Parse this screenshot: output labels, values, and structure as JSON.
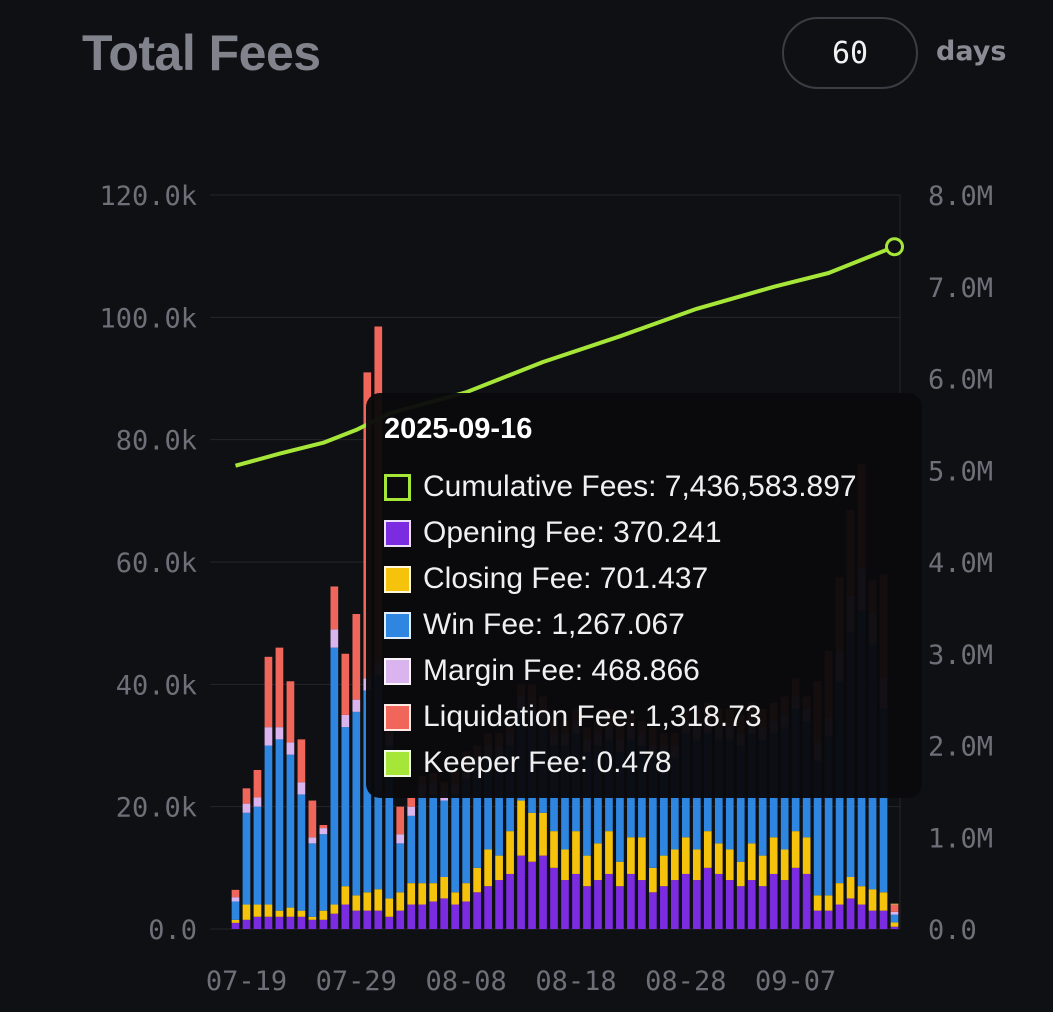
{
  "header": {
    "title": "Total Fees",
    "days_value": "60",
    "days_unit": "days"
  },
  "colors": {
    "opening": "#7b2be0",
    "closing": "#f5c20c",
    "win": "#2e86e0",
    "margin": "#d9b4ef",
    "liquidation": "#f0665a",
    "keeper": "#a6e639",
    "cumulative": "#a6e639"
  },
  "chart_data": {
    "type": "bar",
    "title": "Total Fees",
    "x_tick_labels": [
      "07-19",
      "07-29",
      "08-08",
      "08-18",
      "08-28",
      "09-07"
    ],
    "y_left_tick_labels": [
      "0.0",
      "20.0k",
      "40.0k",
      "60.0k",
      "80.0k",
      "100.0k",
      "120.0k"
    ],
    "y_right_tick_labels": [
      "0.0",
      "1.0M",
      "2.0M",
      "3.0M",
      "4.0M",
      "5.0M",
      "6.0M",
      "7.0M",
      "8.0M"
    ],
    "ylim_left": [
      0,
      120000
    ],
    "ylim_right": [
      0,
      8000000
    ],
    "stack_order": [
      "Opening Fee",
      "Closing Fee",
      "Win Fee",
      "Margin Fee",
      "Liquidation Fee",
      "Keeper Fee"
    ],
    "bars": [
      {
        "date": "07-18",
        "values": [
          1000,
          500,
          3000,
          700,
          1200,
          0
        ]
      },
      {
        "date": "07-19",
        "values": [
          1500,
          2500,
          15000,
          1500,
          2500,
          0
        ]
      },
      {
        "date": "07-20",
        "values": [
          2000,
          2000,
          16000,
          1500,
          4500,
          0
        ]
      },
      {
        "date": "07-21",
        "values": [
          2000,
          2000,
          26000,
          3000,
          11500,
          0
        ]
      },
      {
        "date": "07-22",
        "values": [
          2000,
          1000,
          28000,
          2000,
          13000,
          0
        ]
      },
      {
        "date": "07-23",
        "values": [
          2000,
          1500,
          25000,
          2000,
          10000,
          0
        ]
      },
      {
        "date": "07-24",
        "values": [
          2000,
          1000,
          19000,
          2000,
          7000,
          0
        ]
      },
      {
        "date": "07-25",
        "values": [
          1500,
          500,
          12000,
          1000,
          6000,
          0
        ]
      },
      {
        "date": "07-26",
        "values": [
          1500,
          1500,
          12500,
          1000,
          500,
          0
        ]
      },
      {
        "date": "07-27",
        "values": [
          2500,
          1500,
          42000,
          3000,
          7000,
          0
        ]
      },
      {
        "date": "07-28",
        "values": [
          4000,
          3000,
          26000,
          2000,
          10000,
          0
        ]
      },
      {
        "date": "07-29",
        "values": [
          3000,
          2500,
          30000,
          2000,
          14000,
          0
        ]
      },
      {
        "date": "07-30",
        "values": [
          3000,
          3000,
          33000,
          2000,
          50000,
          0
        ]
      },
      {
        "date": "07-31",
        "values": [
          3000,
          3500,
          35000,
          2000,
          55000,
          0
        ]
      },
      {
        "date": "08-01",
        "values": [
          2000,
          3000,
          25000,
          2000,
          3000,
          0
        ]
      },
      {
        "date": "08-02",
        "values": [
          3000,
          3000,
          8000,
          1500,
          4500,
          0
        ]
      },
      {
        "date": "08-03",
        "values": [
          4000,
          3500,
          11000,
          1500,
          1500,
          0
        ]
      },
      {
        "date": "08-04",
        "values": [
          4000,
          3500,
          14000,
          2000,
          1500,
          0
        ]
      },
      {
        "date": "08-05",
        "values": [
          4500,
          3000,
          14500,
          2000,
          1500,
          0
        ]
      },
      {
        "date": "08-06",
        "values": [
          5000,
          3500,
          12500,
          1500,
          1500,
          0
        ]
      },
      {
        "date": "08-07",
        "values": [
          4000,
          2000,
          16000,
          1500,
          2500,
          0
        ]
      },
      {
        "date": "08-08",
        "values": [
          4500,
          3000,
          17000,
          2000,
          2500,
          0
        ]
      },
      {
        "date": "08-09",
        "values": [
          6000,
          4000,
          16000,
          2000,
          2000,
          0
        ]
      },
      {
        "date": "08-10",
        "values": [
          7000,
          6000,
          15000,
          2000,
          2000,
          0
        ]
      },
      {
        "date": "08-11",
        "values": [
          8000,
          4000,
          16000,
          2000,
          2000,
          0
        ]
      },
      {
        "date": "08-12",
        "values": [
          9000,
          7000,
          14000,
          2000,
          1000,
          0
        ]
      },
      {
        "date": "08-13",
        "values": [
          12000,
          9000,
          15000,
          2000,
          2000,
          0
        ]
      },
      {
        "date": "08-14",
        "values": [
          11000,
          8000,
          16000,
          2000,
          3000,
          0
        ]
      },
      {
        "date": "08-15",
        "values": [
          12000,
          7000,
          15000,
          2000,
          2000,
          0
        ]
      },
      {
        "date": "08-16",
        "values": [
          10000,
          6000,
          14000,
          2000,
          2000,
          0
        ]
      },
      {
        "date": "08-17",
        "values": [
          8000,
          5000,
          17000,
          2000,
          2000,
          0
        ]
      },
      {
        "date": "08-18",
        "values": [
          9000,
          7000,
          16000,
          2000,
          2000,
          0
        ]
      },
      {
        "date": "08-19",
        "values": [
          7000,
          5000,
          17000,
          2000,
          2000,
          0
        ]
      },
      {
        "date": "08-20",
        "values": [
          8000,
          6000,
          16000,
          2000,
          2000,
          0
        ]
      },
      {
        "date": "08-21",
        "values": [
          9000,
          7000,
          15000,
          2000,
          3000,
          0
        ]
      },
      {
        "date": "08-22",
        "values": [
          7000,
          4000,
          18000,
          2000,
          3000,
          0
        ]
      },
      {
        "date": "08-23",
        "values": [
          9000,
          6000,
          16000,
          2000,
          2000,
          0
        ]
      },
      {
        "date": "08-24",
        "values": [
          8000,
          7000,
          15000,
          2000,
          2000,
          0
        ]
      },
      {
        "date": "08-25",
        "values": [
          6000,
          4000,
          18000,
          2000,
          3000,
          0
        ]
      },
      {
        "date": "08-26",
        "values": [
          7000,
          5000,
          16000,
          2000,
          2000,
          0
        ]
      },
      {
        "date": "08-27",
        "values": [
          8000,
          5000,
          15000,
          2000,
          2000,
          0
        ]
      },
      {
        "date": "08-28",
        "values": [
          9000,
          6000,
          17000,
          2000,
          2000,
          0
        ]
      },
      {
        "date": "08-29",
        "values": [
          8000,
          5000,
          18000,
          2000,
          3000,
          0
        ]
      },
      {
        "date": "08-30",
        "values": [
          10000,
          6000,
          16000,
          2000,
          3000,
          0
        ]
      },
      {
        "date": "08-31",
        "values": [
          9000,
          5000,
          17000,
          2000,
          3000,
          0
        ]
      },
      {
        "date": "09-01",
        "values": [
          8000,
          5000,
          18000,
          2000,
          3000,
          0
        ]
      },
      {
        "date": "09-02",
        "values": [
          7000,
          4000,
          19000,
          2000,
          3000,
          0
        ]
      },
      {
        "date": "09-03",
        "values": [
          8000,
          6000,
          18000,
          2000,
          3000,
          0
        ]
      },
      {
        "date": "09-04",
        "values": [
          7000,
          5000,
          19000,
          2000,
          3000,
          0
        ]
      },
      {
        "date": "09-05",
        "values": [
          9000,
          6000,
          17000,
          2000,
          3000,
          0
        ]
      },
      {
        "date": "09-06",
        "values": [
          8000,
          5000,
          20000,
          2000,
          3000,
          0
        ]
      },
      {
        "date": "09-07",
        "values": [
          10000,
          6000,
          20000,
          2000,
          3000,
          0
        ]
      },
      {
        "date": "09-08",
        "values": [
          9000,
          6000,
          19000,
          2000,
          2000,
          0
        ]
      },
      {
        "date": "09-09",
        "values": [
          3000,
          2500,
          22000,
          3000,
          10000,
          0
        ]
      },
      {
        "date": "09-10",
        "values": [
          3000,
          2500,
          26000,
          3000,
          11000,
          0
        ]
      },
      {
        "date": "09-11",
        "values": [
          4000,
          3500,
          33000,
          5000,
          12000,
          0
        ]
      },
      {
        "date": "09-12",
        "values": [
          5000,
          3500,
          40000,
          6000,
          14000,
          0
        ]
      },
      {
        "date": "09-13",
        "values": [
          4000,
          3000,
          45000,
          7000,
          17000,
          0
        ]
      },
      {
        "date": "09-14",
        "values": [
          3000,
          3500,
          40000,
          5000,
          5500,
          0
        ]
      },
      {
        "date": "09-15",
        "values": [
          3000,
          3000,
          30000,
          5000,
          17000,
          0
        ]
      },
      {
        "date": "09-16",
        "values": [
          370.241,
          701.437,
          1267.067,
          468.866,
          1318.73,
          0.478
        ]
      }
    ],
    "series": [
      {
        "name": "Cumulative Fees",
        "axis": "right",
        "type": "line",
        "x": [
          "07-18",
          "07-22",
          "07-26",
          "07-29",
          "08-01",
          "08-08",
          "08-15",
          "08-22",
          "08-29",
          "09-05",
          "09-10",
          "09-16"
        ],
        "y": [
          5050000,
          5180000,
          5300000,
          5440000,
          5620000,
          5850000,
          6180000,
          6460000,
          6760000,
          7000000,
          7150000,
          7436583.897
        ]
      },
      {
        "name": "Opening Fee",
        "axis": "left"
      },
      {
        "name": "Closing Fee",
        "axis": "left"
      },
      {
        "name": "Win Fee",
        "axis": "left"
      },
      {
        "name": "Margin Fee",
        "axis": "left"
      },
      {
        "name": "Liquidation Fee",
        "axis": "left"
      },
      {
        "name": "Keeper Fee",
        "axis": "left"
      }
    ]
  },
  "tooltip": {
    "date": "2025-09-16",
    "rows": [
      {
        "label": "Cumulative Fees: 7,436,583.897",
        "color": "#a6e639",
        "outline": true
      },
      {
        "label": "Opening Fee: 370.241",
        "color": "#7b2be0"
      },
      {
        "label": "Closing Fee: 701.437",
        "color": "#f5c20c"
      },
      {
        "label": "Win Fee: 1,267.067",
        "color": "#2e86e0"
      },
      {
        "label": "Margin Fee: 468.866",
        "color": "#d9b4ef"
      },
      {
        "label": "Liquidation Fee: 1,318.73",
        "color": "#f0665a"
      },
      {
        "label": "Keeper Fee: 0.478",
        "color": "#a6e639"
      }
    ]
  }
}
